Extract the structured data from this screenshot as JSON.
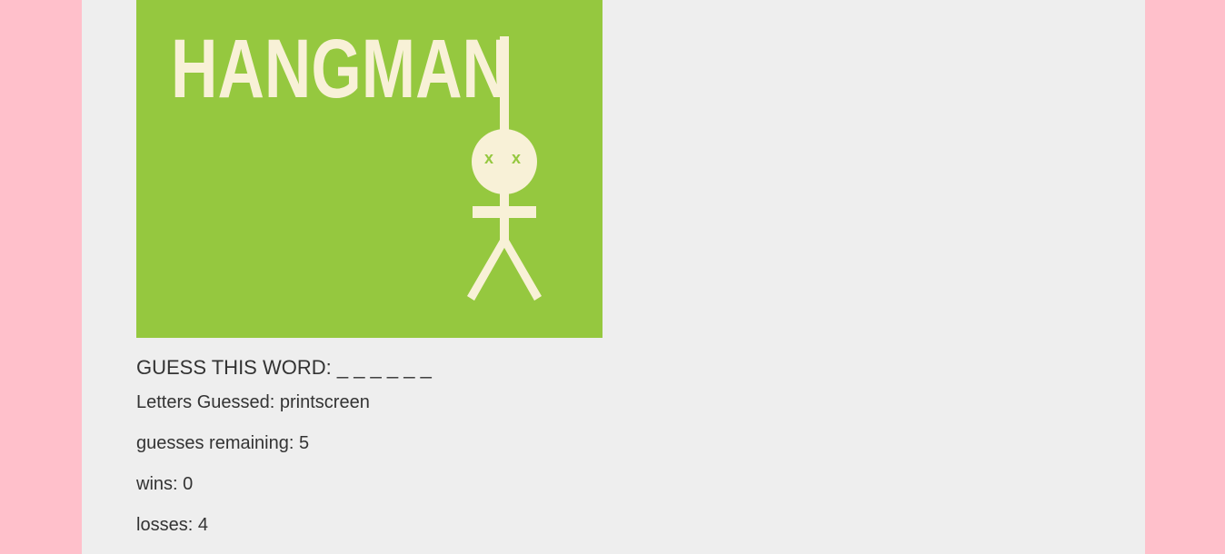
{
  "colors": {
    "page_background": "#ffc0cb",
    "container_background": "#eeeeee",
    "hero_background": "#95c83f",
    "hero_figure": "#f8f1d7",
    "text": "#333333"
  },
  "hero": {
    "title": "HANGMAN",
    "eye_mark": "x",
    "icon": "hangman-figure-icon"
  },
  "word": {
    "label": "GUESS THIS WORD:",
    "blanks": "_ _ _ _ _ _"
  },
  "stats": {
    "letters_guessed_label": "Letters Guessed:",
    "letters_guessed_value": "printscreen",
    "guesses_remaining_label": "guesses remaining:",
    "guesses_remaining_value": "5",
    "wins_label": "wins:",
    "wins_value": "0",
    "losses_label": "losses:",
    "losses_value": "4"
  }
}
